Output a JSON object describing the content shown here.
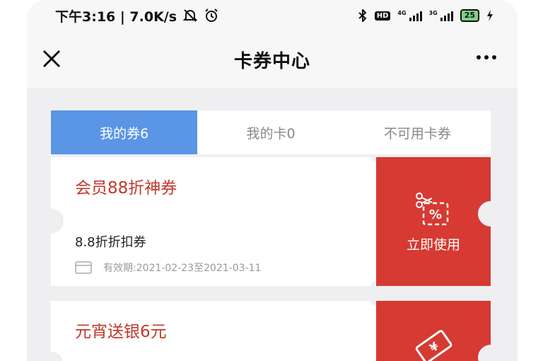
{
  "status_bar": {
    "time_and_speed": "下午3:16 | 7.0K/s",
    "hd_badge": "HD",
    "signal_1_label": "4G",
    "signal_2_label": "3G",
    "battery": "25"
  },
  "nav": {
    "title": "卡券中心"
  },
  "tabs": [
    {
      "label": "我的券6",
      "active": true
    },
    {
      "label": "我的卡0",
      "active": false
    },
    {
      "label": "不可用卡券",
      "active": false
    }
  ],
  "coupons": [
    {
      "title": "会员88折神券",
      "description": "8.8折折扣券",
      "validity": "有效期:2021-02-23至2021-03-11",
      "action_label": "立即使用",
      "icon": "scissors-percent-icon"
    },
    {
      "title": "元宵送银6元",
      "icon": "ticket-icon"
    }
  ],
  "colors": {
    "accent_blue": "#5a95e6",
    "coupon_red": "#d63a32",
    "title_red": "#c0392b"
  }
}
